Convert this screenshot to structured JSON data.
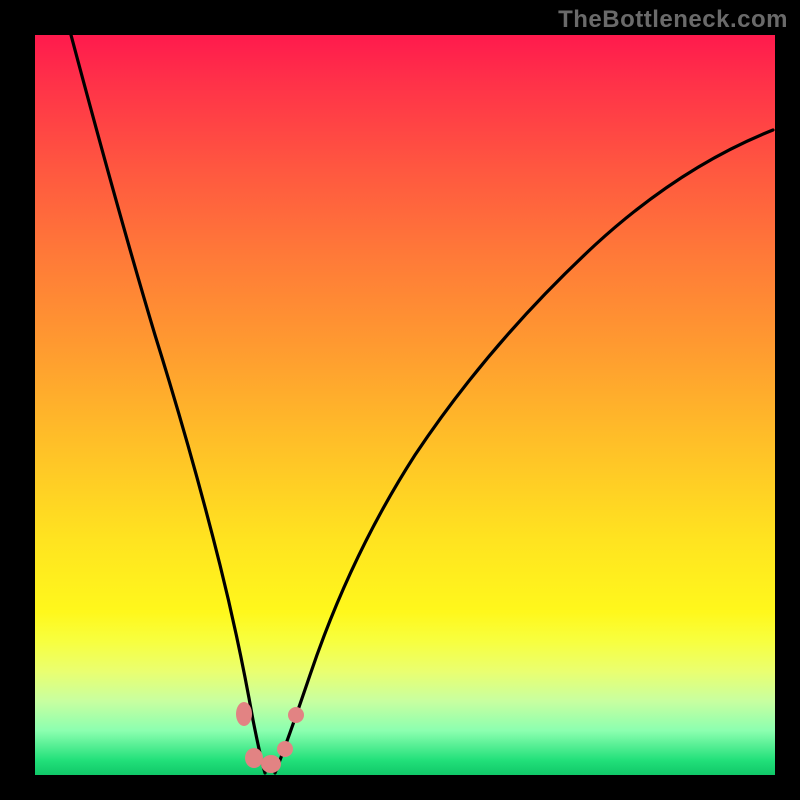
{
  "attribution": "TheBottleneck.com",
  "colors": {
    "frame": "#000000",
    "gradient_top": "#ff1a4d",
    "gradient_bottom": "#10c868",
    "curve": "#000000",
    "marker": "#e28383"
  },
  "chart_data": {
    "type": "line",
    "title": "",
    "xlabel": "",
    "ylabel": "",
    "xlim": [
      0,
      100
    ],
    "ylim": [
      0,
      100
    ],
    "grid": false,
    "legend": false,
    "background": "vertical-gradient red→orange→yellow→green",
    "series": [
      {
        "name": "left-curve",
        "x": [
          3,
          5,
          8,
          10,
          13,
          15,
          18,
          20,
          22,
          24,
          26,
          27,
          28,
          29,
          30
        ],
        "y": [
          100,
          90,
          78,
          70,
          60,
          52,
          42,
          34,
          26,
          18,
          10,
          6,
          3,
          1,
          0
        ]
      },
      {
        "name": "right-curve",
        "x": [
          32,
          33,
          35,
          38,
          42,
          46,
          50,
          55,
          60,
          66,
          72,
          78,
          85,
          92,
          100
        ],
        "y": [
          0,
          2,
          6,
          13,
          22,
          30,
          37,
          45,
          52,
          59,
          65,
          70,
          76,
          81,
          86
        ]
      }
    ],
    "markers": [
      {
        "x": 27.0,
        "y": 8.0,
        "shape": "oval"
      },
      {
        "x": 28.5,
        "y": 2.0,
        "shape": "oval"
      },
      {
        "x": 31.0,
        "y": 1.5,
        "shape": "oval"
      },
      {
        "x": 33.0,
        "y": 3.5,
        "shape": "round"
      },
      {
        "x": 34.5,
        "y": 8.0,
        "shape": "round"
      }
    ],
    "notes": "Values estimated from pixel positions relative to the 740×740 plot area; no axis ticks or labels are rendered."
  }
}
